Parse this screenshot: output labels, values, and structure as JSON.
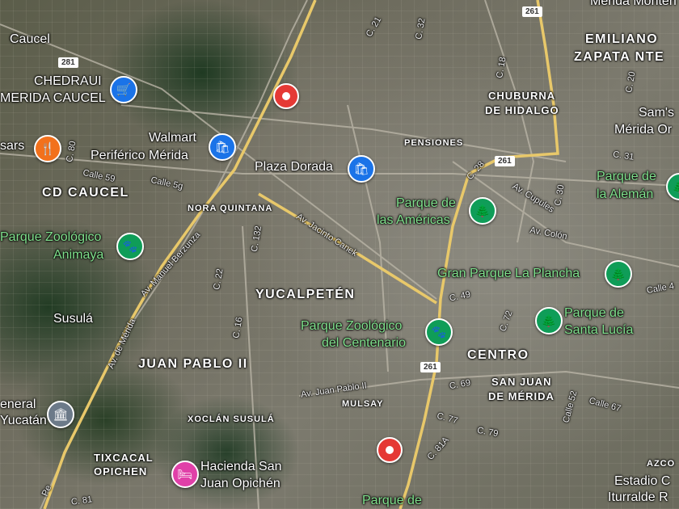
{
  "areas": {
    "caucel": "Caucel",
    "cd_caucel": "CD CAUCEL",
    "emiliano_zapata_1": "EMILIANO",
    "emiliano_zapata_2": "ZAPATA NTE",
    "chuburna_1": "CHUBURNA",
    "chuburna_2": "DE HIDALGO",
    "pensiones": "PENSIONES",
    "nora_quintana": "NORA QUINTANA",
    "yucalpeten": "YUCALPETÉN",
    "juan_pablo": "JUAN PABLO II",
    "centro": "CENTRO",
    "san_juan_1": "SAN JUAN",
    "san_juan_2": "DE MÉRIDA",
    "susula": "Susulá",
    "xoclan": "XOCLÁN SUSULÁ",
    "tixcacal_1": "TIXCACAL",
    "tixcacal_2": "OPICHEN",
    "mulsay": "MULSAY",
    "merida_monte": "Mérida Monten",
    "sams": "Sam's",
    "merida_or": "Mérida Or",
    "azco": "AZCO",
    "estadio_1": "Estadio C",
    "estadio_2": "Iturralde R",
    "general": "eneral",
    "yucatan": "Yucatán"
  },
  "places": {
    "chedraui_1": "CHEDRAUI",
    "chedraui_2": "MERIDA CAUCEL",
    "walmart_1": "Walmart",
    "walmart_2": "Periférico Mérida",
    "plaza_dorada": "Plaza Dorada",
    "sars": "sars",
    "hacienda_1": "Hacienda San",
    "hacienda_2": "Juan Opichén"
  },
  "parks": {
    "americas_1": "Parque de",
    "americas_2": "las Américas",
    "aleman_1": "Parque de",
    "aleman_2": "la Alemán",
    "zoo_animaya_1": "Parque Zoológico",
    "zoo_animaya_2": "Animaya",
    "plancha": "Gran Parque La Plancha",
    "zoo_centenario_1": "Parque Zoológico",
    "zoo_centenario_2": "del Centenario",
    "santa_lucia_1": "Parque de",
    "santa_lucia_2": "Santa Lucía",
    "parque_bottom": "Parque de"
  },
  "streets": {
    "calle59": "Calle 59",
    "calle5g": "Calle 5g",
    "jacinto_canek": "Av. Jacinto Canek",
    "cupules": "Av. Cupules",
    "colon": "Av. Colón",
    "manuel_berzunza": "Av. Manuel Berzunza",
    "av_merida": "Av. de Mérida",
    "juan_pablo_av": "Av. Juan Pablo II",
    "c21": "C. 21",
    "c32": "C. 32",
    "c18": "C. 18",
    "c20": "C. 20",
    "c28": "C. 28",
    "c30": "C. 30",
    "c31": "C. 31",
    "c80": "C. 80",
    "c132": "C. 132",
    "c22": "C. 22",
    "c16": "C. 16",
    "c49": "C. 49",
    "c72": "C. 72",
    "c69": "C. 69",
    "c77": "C. 77",
    "c79": "C. 79",
    "c81a": "C. 81A",
    "c81": "C. 81",
    "calle52": "Calle 52",
    "calle67": "Calle 67",
    "calle4": "Calle 4",
    "c_pe": "Pe"
  },
  "shields": {
    "s281": "281",
    "s261_top": "261",
    "s261_mid": "261",
    "s261_low": "261"
  },
  "icons": {
    "shopping_cart": "shopping-cart-icon",
    "shopping_bag": "shopping-bag-icon",
    "restaurant": "restaurant-icon",
    "park_tree": "tree-icon",
    "zoo_paw": "paw-icon",
    "hotel_bed": "bed-icon",
    "museum": "museum-icon",
    "location_marker": "location-marker-icon"
  },
  "colors": {
    "park_label": "#7fe08c",
    "shop_pin": "#1a73e8",
    "park_pin": "#0f9d58",
    "food_pin": "#f2711c",
    "hotel_pin": "#e040a8",
    "marker": "#e53935",
    "highway": "#e8c86a"
  }
}
